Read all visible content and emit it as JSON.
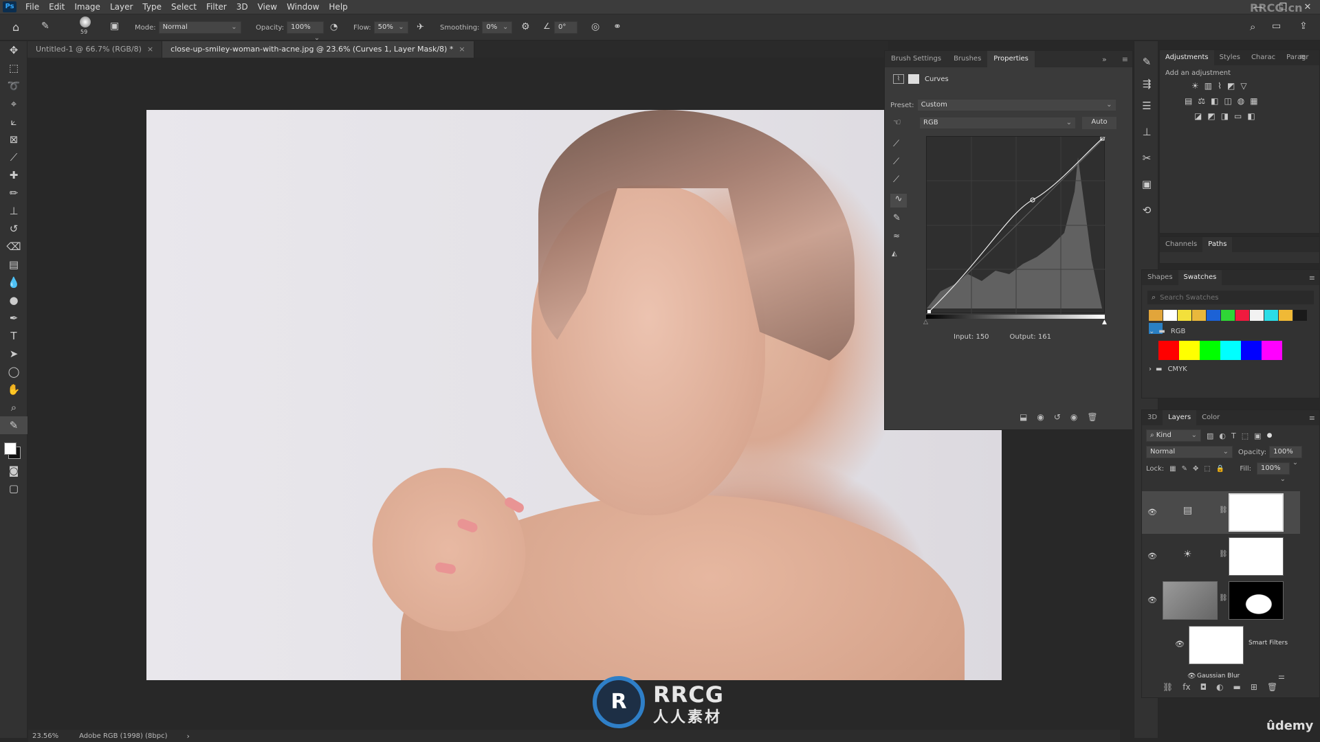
{
  "menubar": {
    "logo": "Ps",
    "items": [
      "File",
      "Edit",
      "Image",
      "Layer",
      "Type",
      "Select",
      "Filter",
      "3D",
      "View",
      "Window",
      "Help"
    ],
    "watermark": "RRCG.cn",
    "controls": [
      "—",
      "❐",
      "✕"
    ]
  },
  "options": {
    "brush_size": "59",
    "mode_label": "Mode:",
    "mode_value": "Normal",
    "opacity_label": "Opacity:",
    "opacity_value": "100%",
    "flow_label": "Flow:",
    "flow_value": "50%",
    "smoothing_label": "Smoothing:",
    "smoothing_value": "0%",
    "angle_value": "0°"
  },
  "tabs": [
    {
      "label": "Untitled-1 @ 66.7% (RGB/8)",
      "close": "×"
    },
    {
      "label": "close-up-smiley-woman-with-acne.jpg @ 23.6% (Curves 1, Layer Mask/8) *",
      "close": "×"
    }
  ],
  "properties": {
    "tabs": [
      "Brush Settings",
      "Brushes",
      "Properties"
    ],
    "panel_title": "Curves",
    "preset_label": "Preset:",
    "preset_value": "Custom",
    "channel_value": "RGB",
    "auto_label": "Auto",
    "input_label": "Input:",
    "input_value": "150",
    "output_label": "Output:",
    "output_value": "161"
  },
  "adjustments": {
    "tabs": [
      "Adjustments",
      "Styles",
      "Charac",
      "Paragr"
    ],
    "hint": "Add an adjustment"
  },
  "channels": {
    "tabs": [
      "Channels",
      "Paths"
    ]
  },
  "swatches": {
    "tabs": [
      "Shapes",
      "Swatches"
    ],
    "search_placeholder": "Search Swatches",
    "recent": [
      "#e2a53a",
      "#ffffff",
      "#f3e03b",
      "#e9b83c",
      "#1c62d6",
      "#2fd636",
      "#f01a3e",
      "#f2f2f2",
      "#2bdde6",
      "#f0b936",
      "#1a1a1a",
      "#2a80c4"
    ],
    "groups": [
      {
        "name": "RGB",
        "colors": [
          "#ff0000",
          "#ffff00",
          "#00ff00",
          "#00ffff",
          "#0000ff",
          "#ff00ff"
        ]
      },
      {
        "name": "CMYK"
      }
    ]
  },
  "layers": {
    "tabs": [
      "3D",
      "Layers",
      "Color"
    ],
    "filter_label": "Kind",
    "blend_mode": "Normal",
    "opacity_label": "Opacity:",
    "opacity_value": "100%",
    "lock_label": "Lock:",
    "fill_label": "Fill:",
    "fill_value": "100%",
    "smart_filters_label": "Smart Filters",
    "gaussian_blur_label": "Gaussian Blur"
  },
  "status": {
    "zoom": "23.56%",
    "profile": "Adobe RGB (1998) (8bpc)",
    "arrow": "›"
  },
  "watermark_brand": {
    "top": "RRCG",
    "bottom": "人人素材"
  },
  "udemy": "ûdemy"
}
